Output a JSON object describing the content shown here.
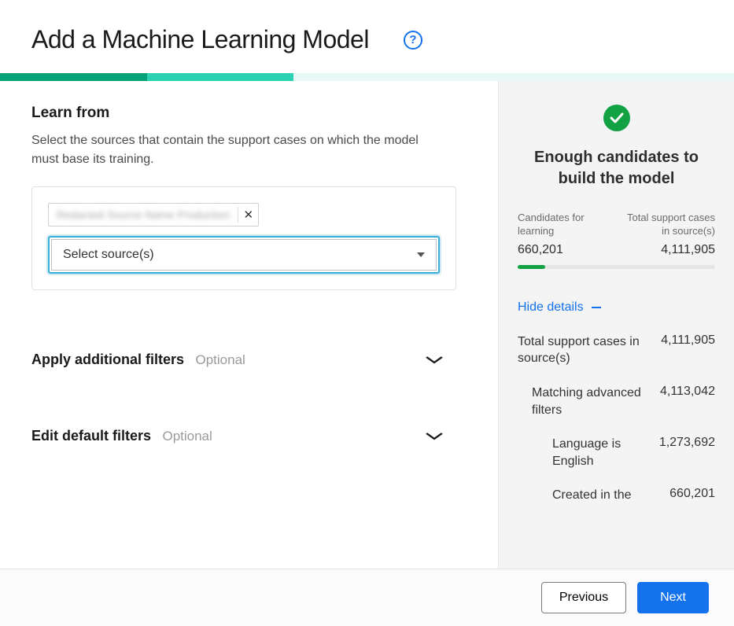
{
  "header": {
    "title": "Add a Machine Learning Model",
    "help_tooltip": "?"
  },
  "learn_from": {
    "title": "Learn from",
    "description": "Select the sources that contain the support cases on which the model must base its training.",
    "chip_label": "Redacted Source Name Production",
    "select_placeholder": "Select source(s)"
  },
  "accordions": {
    "additional": {
      "label": "Apply additional filters",
      "optional": "Optional"
    },
    "default": {
      "label": "Edit default filters",
      "optional": "Optional"
    }
  },
  "summary": {
    "title": "Enough candidates to build the model",
    "candidates_label": "Candidates for learning",
    "total_label": "Total support cases in source(s)",
    "candidates_value": "660,201",
    "total_value": "4,111,905",
    "hide_details": "Hide details",
    "rows": {
      "total_in_sources": {
        "label": "Total support cases in source(s)",
        "value": "4,111,905"
      },
      "matching_adv": {
        "label": "Matching advanced filters",
        "value": "4,113,042"
      },
      "lang_en": {
        "label": "Language is English",
        "value": "1,273,692"
      },
      "created_in": {
        "label": "Created in the",
        "value": "660,201"
      }
    }
  },
  "footer": {
    "previous": "Previous",
    "next": "Next"
  }
}
